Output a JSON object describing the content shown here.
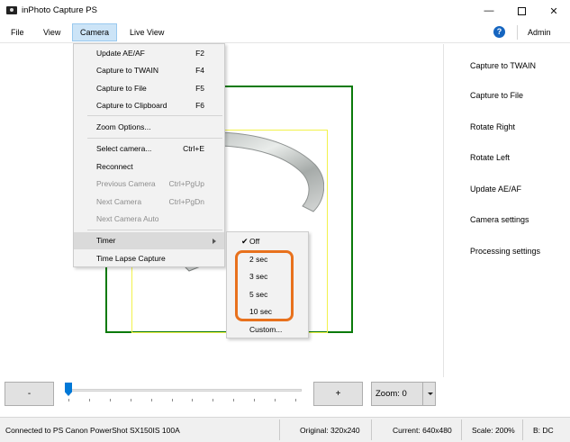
{
  "window": {
    "title": "inPhoto Capture PS",
    "minimize_glyph": "—",
    "close_glyph": "✕"
  },
  "menubar": {
    "items": [
      "File",
      "View",
      "Camera",
      "Live View"
    ],
    "active": "Camera",
    "help_glyph": "?",
    "admin": "Admin"
  },
  "camera_menu": {
    "items": [
      {
        "label": "Update AE/AF",
        "shortcut": "F2",
        "disabled": false
      },
      {
        "label": "Capture to TWAIN",
        "shortcut": "F4",
        "disabled": false
      },
      {
        "label": "Capture to File",
        "shortcut": "F5",
        "disabled": false
      },
      {
        "label": "Capture to Clipboard",
        "shortcut": "F6",
        "disabled": false
      },
      {
        "label": "Zoom Options...",
        "shortcut": "",
        "disabled": false
      },
      {
        "label": "Select camera...",
        "shortcut": "Ctrl+E",
        "disabled": false
      },
      {
        "label": "Reconnect",
        "shortcut": "",
        "disabled": false
      },
      {
        "label": "Previous Camera",
        "shortcut": "Ctrl+PgUp",
        "disabled": true
      },
      {
        "label": "Next Camera",
        "shortcut": "Ctrl+PgDn",
        "disabled": true
      },
      {
        "label": "Next Camera Auto",
        "shortcut": "",
        "disabled": true
      },
      {
        "label": "Timer",
        "shortcut": "",
        "disabled": false,
        "submenu": true
      },
      {
        "label": "Time Lapse Capture",
        "shortcut": "",
        "disabled": false
      }
    ]
  },
  "timer_menu": {
    "items": [
      "Off",
      "2 sec",
      "3 sec",
      "5 sec",
      "10 sec",
      "Custom..."
    ],
    "checked": "Off",
    "check_glyph": "✔"
  },
  "right_panel": {
    "links": [
      "Capture to TWAIN",
      "Capture to File",
      "Rotate Right",
      "Rotate Left",
      "Update AE/AF",
      "Camera settings",
      "Processing settings"
    ]
  },
  "zoom": {
    "minus": "-",
    "plus": "+",
    "label": "Zoom: 0",
    "slider_value": 0
  },
  "statusbar": {
    "connection": "Connected to PS Canon PowerShot SX150IS 100A",
    "original": "Original: 320x240",
    "current": "Current: 640x480",
    "scale": "Scale: 200%",
    "bits": "B: DC"
  },
  "colors": {
    "crop_outer": "#0a7a0a",
    "crop_inner": "#f2f24a",
    "highlight": "#e8711d",
    "menu_active": "#cce4f7",
    "slider": "#0078d7"
  }
}
